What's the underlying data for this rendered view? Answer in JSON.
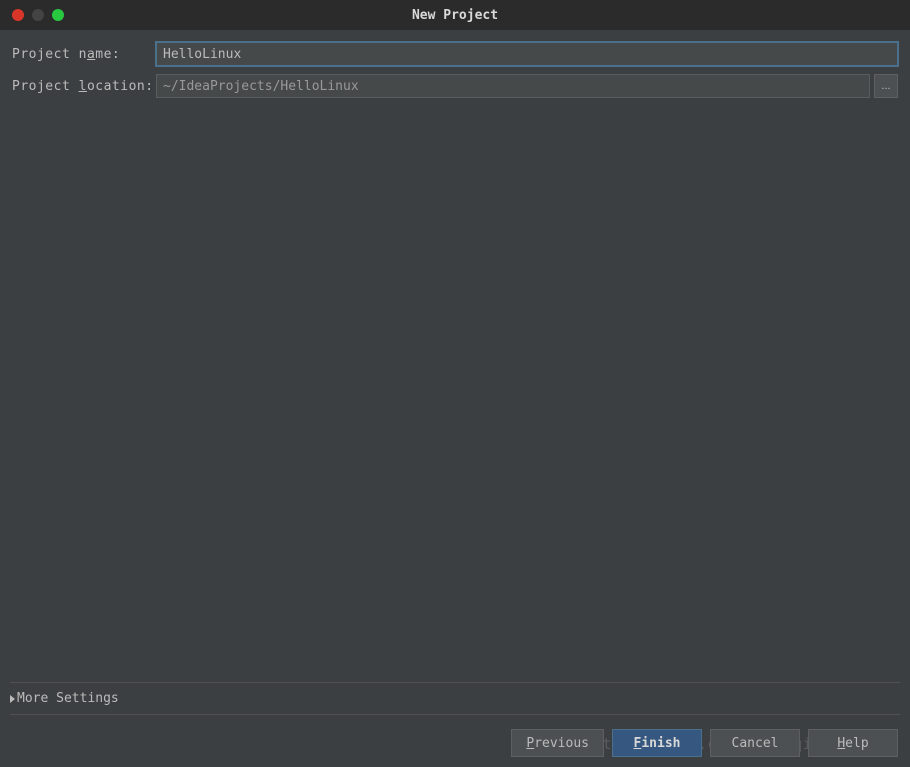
{
  "window": {
    "title": "New Project"
  },
  "form": {
    "name_label_prefix": "Project n",
    "name_label_mnemonic": "a",
    "name_label_suffix": "me:",
    "name_value": "HelloLinux",
    "location_label_prefix": "Project ",
    "location_label_mnemonic": "l",
    "location_label_suffix": "ocation:",
    "location_value": "~/IdeaProjects/HelloLinux",
    "browse_label": "..."
  },
  "more_settings": {
    "label_prefix": "Mor",
    "label_mnemonic": "e",
    "label_suffix": " Settings"
  },
  "buttons": {
    "previous_mnemonic": "P",
    "previous_suffix": "revious",
    "finish_mnemonic": "F",
    "finish_suffix": "inish",
    "cancel": "Cancel",
    "help_mnemonic": "H",
    "help_suffix": "elp"
  },
  "watermark": "http://blog.csdn.net/qinkang1993"
}
